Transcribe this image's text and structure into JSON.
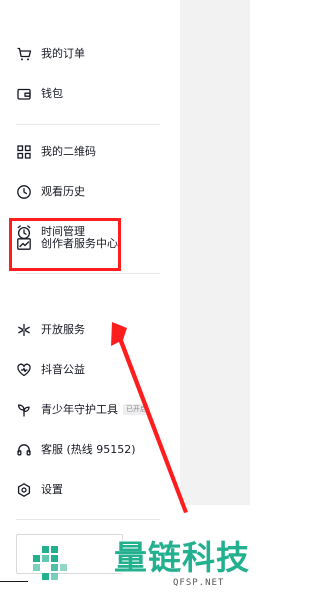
{
  "menu": {
    "my_orders": "我的订单",
    "wallet": "钱包",
    "my_qr_code": "我的二维码",
    "watch_history": "观看历史",
    "time_management": "时间管理",
    "creator_center": "创作者服务中心",
    "open_services": "开放服务",
    "douyin_charity": "抖音公益",
    "youth_guard": "青少年守护工具",
    "youth_guard_badge": "已开启",
    "customer_service": "客服 (热线 95152)",
    "settings": "设置"
  },
  "annotation": {
    "highlight_color": "#ff1e1e"
  },
  "watermark": {
    "title": "量链科技",
    "subtitle": "QFSP.NET",
    "color": "#22b08f"
  }
}
